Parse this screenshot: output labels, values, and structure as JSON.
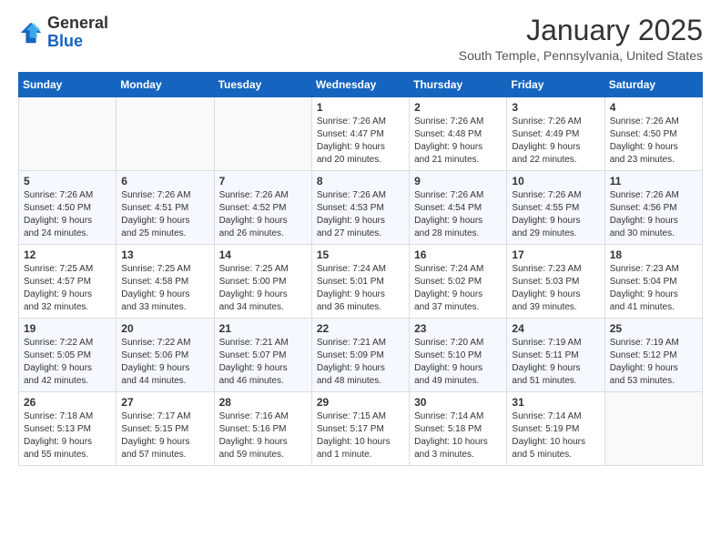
{
  "logo": {
    "general": "General",
    "blue": "Blue"
  },
  "title": "January 2025",
  "location": "South Temple, Pennsylvania, United States",
  "weekdays": [
    "Sunday",
    "Monday",
    "Tuesday",
    "Wednesday",
    "Thursday",
    "Friday",
    "Saturday"
  ],
  "weeks": [
    [
      {
        "day": "",
        "info": ""
      },
      {
        "day": "",
        "info": ""
      },
      {
        "day": "",
        "info": ""
      },
      {
        "day": "1",
        "info": "Sunrise: 7:26 AM\nSunset: 4:47 PM\nDaylight: 9 hours\nand 20 minutes."
      },
      {
        "day": "2",
        "info": "Sunrise: 7:26 AM\nSunset: 4:48 PM\nDaylight: 9 hours\nand 21 minutes."
      },
      {
        "day": "3",
        "info": "Sunrise: 7:26 AM\nSunset: 4:49 PM\nDaylight: 9 hours\nand 22 minutes."
      },
      {
        "day": "4",
        "info": "Sunrise: 7:26 AM\nSunset: 4:50 PM\nDaylight: 9 hours\nand 23 minutes."
      }
    ],
    [
      {
        "day": "5",
        "info": "Sunrise: 7:26 AM\nSunset: 4:50 PM\nDaylight: 9 hours\nand 24 minutes."
      },
      {
        "day": "6",
        "info": "Sunrise: 7:26 AM\nSunset: 4:51 PM\nDaylight: 9 hours\nand 25 minutes."
      },
      {
        "day": "7",
        "info": "Sunrise: 7:26 AM\nSunset: 4:52 PM\nDaylight: 9 hours\nand 26 minutes."
      },
      {
        "day": "8",
        "info": "Sunrise: 7:26 AM\nSunset: 4:53 PM\nDaylight: 9 hours\nand 27 minutes."
      },
      {
        "day": "9",
        "info": "Sunrise: 7:26 AM\nSunset: 4:54 PM\nDaylight: 9 hours\nand 28 minutes."
      },
      {
        "day": "10",
        "info": "Sunrise: 7:26 AM\nSunset: 4:55 PM\nDaylight: 9 hours\nand 29 minutes."
      },
      {
        "day": "11",
        "info": "Sunrise: 7:26 AM\nSunset: 4:56 PM\nDaylight: 9 hours\nand 30 minutes."
      }
    ],
    [
      {
        "day": "12",
        "info": "Sunrise: 7:25 AM\nSunset: 4:57 PM\nDaylight: 9 hours\nand 32 minutes."
      },
      {
        "day": "13",
        "info": "Sunrise: 7:25 AM\nSunset: 4:58 PM\nDaylight: 9 hours\nand 33 minutes."
      },
      {
        "day": "14",
        "info": "Sunrise: 7:25 AM\nSunset: 5:00 PM\nDaylight: 9 hours\nand 34 minutes."
      },
      {
        "day": "15",
        "info": "Sunrise: 7:24 AM\nSunset: 5:01 PM\nDaylight: 9 hours\nand 36 minutes."
      },
      {
        "day": "16",
        "info": "Sunrise: 7:24 AM\nSunset: 5:02 PM\nDaylight: 9 hours\nand 37 minutes."
      },
      {
        "day": "17",
        "info": "Sunrise: 7:23 AM\nSunset: 5:03 PM\nDaylight: 9 hours\nand 39 minutes."
      },
      {
        "day": "18",
        "info": "Sunrise: 7:23 AM\nSunset: 5:04 PM\nDaylight: 9 hours\nand 41 minutes."
      }
    ],
    [
      {
        "day": "19",
        "info": "Sunrise: 7:22 AM\nSunset: 5:05 PM\nDaylight: 9 hours\nand 42 minutes."
      },
      {
        "day": "20",
        "info": "Sunrise: 7:22 AM\nSunset: 5:06 PM\nDaylight: 9 hours\nand 44 minutes."
      },
      {
        "day": "21",
        "info": "Sunrise: 7:21 AM\nSunset: 5:07 PM\nDaylight: 9 hours\nand 46 minutes."
      },
      {
        "day": "22",
        "info": "Sunrise: 7:21 AM\nSunset: 5:09 PM\nDaylight: 9 hours\nand 48 minutes."
      },
      {
        "day": "23",
        "info": "Sunrise: 7:20 AM\nSunset: 5:10 PM\nDaylight: 9 hours\nand 49 minutes."
      },
      {
        "day": "24",
        "info": "Sunrise: 7:19 AM\nSunset: 5:11 PM\nDaylight: 9 hours\nand 51 minutes."
      },
      {
        "day": "25",
        "info": "Sunrise: 7:19 AM\nSunset: 5:12 PM\nDaylight: 9 hours\nand 53 minutes."
      }
    ],
    [
      {
        "day": "26",
        "info": "Sunrise: 7:18 AM\nSunset: 5:13 PM\nDaylight: 9 hours\nand 55 minutes."
      },
      {
        "day": "27",
        "info": "Sunrise: 7:17 AM\nSunset: 5:15 PM\nDaylight: 9 hours\nand 57 minutes."
      },
      {
        "day": "28",
        "info": "Sunrise: 7:16 AM\nSunset: 5:16 PM\nDaylight: 9 hours\nand 59 minutes."
      },
      {
        "day": "29",
        "info": "Sunrise: 7:15 AM\nSunset: 5:17 PM\nDaylight: 10 hours\nand 1 minute."
      },
      {
        "day": "30",
        "info": "Sunrise: 7:14 AM\nSunset: 5:18 PM\nDaylight: 10 hours\nand 3 minutes."
      },
      {
        "day": "31",
        "info": "Sunrise: 7:14 AM\nSunset: 5:19 PM\nDaylight: 10 hours\nand 5 minutes."
      },
      {
        "day": "",
        "info": ""
      }
    ]
  ]
}
